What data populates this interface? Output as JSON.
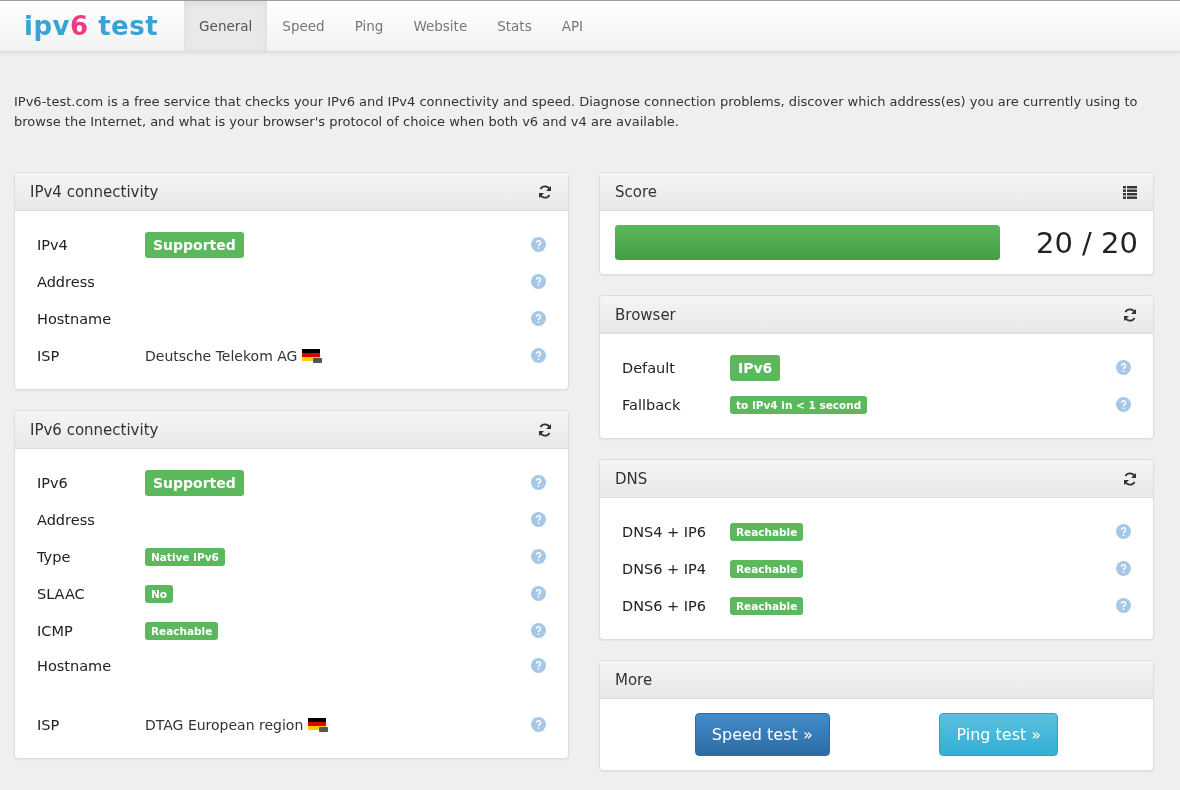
{
  "logo": {
    "parts": [
      {
        "text": "ipv",
        "color": "#3aa3d6"
      },
      {
        "text": "6",
        "color": "#ee3a86"
      },
      {
        "text": " test",
        "color": "#3aa3d6"
      }
    ]
  },
  "nav": [
    {
      "label": "General",
      "selected": true
    },
    {
      "label": "Speed",
      "selected": false
    },
    {
      "label": "Ping",
      "selected": false
    },
    {
      "label": "Website",
      "selected": false
    },
    {
      "label": "Stats",
      "selected": false
    },
    {
      "label": "API",
      "selected": false
    }
  ],
  "intro": "IPv6-test.com is a free service that checks your IPv6 and IPv4 connectivity and speed. Diagnose connection problems, discover which address(es) you are currently using to browse the Internet, and what is your browser's protocol of choice when both v6 and v4 are available.",
  "left_panels": [
    {
      "title": "IPv4 connectivity",
      "kind": "refresh",
      "rows": [
        {
          "label": "IPv4",
          "badge": "Supported",
          "kind": "large"
        },
        {
          "label": "Address"
        },
        {
          "label": "Hostname"
        },
        {
          "label": "ISP",
          "text": "Deutsche Telekom AG",
          "flag": true
        }
      ]
    },
    {
      "title": "IPv6 connectivity",
      "kind": "refresh",
      "rows": [
        {
          "label": "IPv6",
          "badge": "Supported",
          "kind": "large"
        },
        {
          "label": "Address"
        },
        {
          "label": "Type",
          "badge": "Native IPv6",
          "kind": "small"
        },
        {
          "label": "SLAAC",
          "badge": "No",
          "kind": "small"
        },
        {
          "label": "ICMP",
          "badge": "Reachable",
          "kind": "small"
        },
        {
          "label": "Hostname",
          "tall": true
        },
        {
          "label": "ISP",
          "text": "DTAG European region",
          "flag": true
        }
      ]
    }
  ],
  "score": {
    "title": "Score",
    "kind": "list",
    "level": 1,
    "reading": "20 / 20"
  },
  "right_panels": [
    {
      "title": "Browser",
      "kind": "refresh",
      "rows": [
        {
          "label": "Default",
          "badge": "IPv6",
          "kind": "large"
        },
        {
          "label": "Fallback",
          "badge": "to IPv4 in < 1 second",
          "kind": "small"
        }
      ]
    },
    {
      "title": "DNS",
      "kind": "refresh",
      "rows": [
        {
          "label": "DNS4 + IP6",
          "badge": "Reachable",
          "kind": "small"
        },
        {
          "label": "DNS6 + IP4",
          "badge": "Reachable",
          "kind": "small"
        },
        {
          "label": "DNS6 + IP6",
          "badge": "Reachable",
          "kind": "small"
        }
      ]
    }
  ],
  "more": {
    "title": "More",
    "buttons": [
      {
        "label": "Speed test »",
        "kind": "primary"
      },
      {
        "label": "Ping test »",
        "kind": "info"
      }
    ]
  }
}
